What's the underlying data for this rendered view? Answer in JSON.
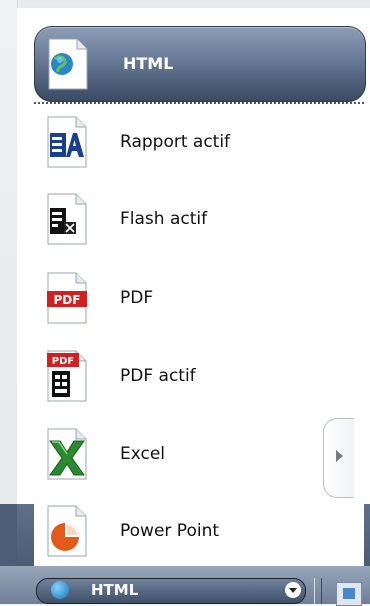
{
  "header": {
    "label": "HTML",
    "icon": "globe-document-icon"
  },
  "items": [
    {
      "label": "Rapport actif",
      "icon": "active-report-icon"
    },
    {
      "label": "Flash actif",
      "icon": "active-flash-icon"
    },
    {
      "label": "PDF",
      "icon": "pdf-icon"
    },
    {
      "label": "PDF actif",
      "icon": "active-pdf-icon"
    },
    {
      "label": "Excel",
      "icon": "excel-icon"
    },
    {
      "label": "Power Point",
      "icon": "powerpoint-icon"
    }
  ],
  "toolbar": {
    "combo_label": "HTML",
    "combo_icon": "globe-icon"
  },
  "colors": {
    "header_top": "#8e9db5",
    "header_bottom": "#3a4a63",
    "pdf_red": "#d21f1f",
    "excel_green": "#2a8a2f",
    "powerpoint_orange": "#e25a1a"
  }
}
